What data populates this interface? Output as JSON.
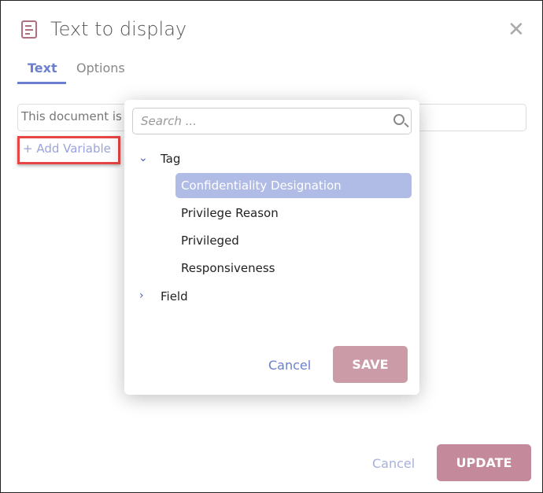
{
  "dialog": {
    "title": "Text to display",
    "icon": "document-icon",
    "close_icon": "close-icon",
    "tabs": [
      {
        "label": "Text",
        "active": true
      },
      {
        "label": "Options",
        "active": false
      }
    ],
    "text_value": "This document is",
    "add_variable": "+ Add Variable",
    "cancel": "Cancel",
    "update": "UPDATE"
  },
  "popup": {
    "search_placeholder": "Search ...",
    "groups": [
      {
        "label": "Tag",
        "expanded": true,
        "items": [
          "Confidentiality Designation",
          "Privilege Reason",
          "Privileged",
          "Responsiveness"
        ],
        "selected": "Confidentiality Designation"
      },
      {
        "label": "Field",
        "expanded": false
      }
    ],
    "cancel": "Cancel",
    "save": "SAVE"
  },
  "colors": {
    "accent": "#6a7fcf",
    "primary_button": "#c4899a",
    "highlight": "#b0bbe6",
    "annotation": "#e84545"
  }
}
